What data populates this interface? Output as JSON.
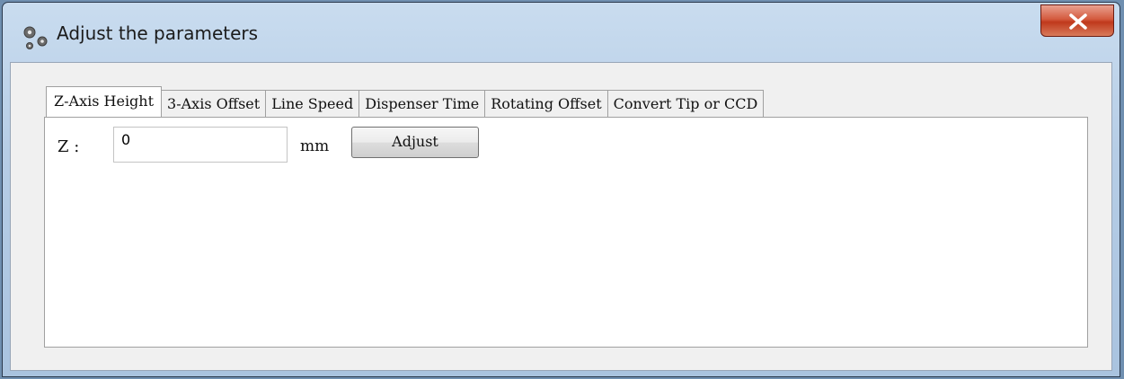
{
  "window": {
    "title": "Adjust the parameters",
    "icon": "gears-icon",
    "close_icon": "close-icon"
  },
  "tabs": [
    {
      "label": "Z-Axis Height",
      "active": true
    },
    {
      "label": "3-Axis Offset",
      "active": false
    },
    {
      "label": "Line Speed",
      "active": false
    },
    {
      "label": "Dispenser Time",
      "active": false
    },
    {
      "label": "Rotating Offset",
      "active": false
    },
    {
      "label": "Convert Tip or CCD",
      "active": false
    }
  ],
  "z_axis_panel": {
    "label": "Z :",
    "value": "0",
    "unit": "mm",
    "adjust_label": "Adjust"
  },
  "colors": {
    "close_button": "#c0391c",
    "titlebar": "#b6cde6"
  }
}
